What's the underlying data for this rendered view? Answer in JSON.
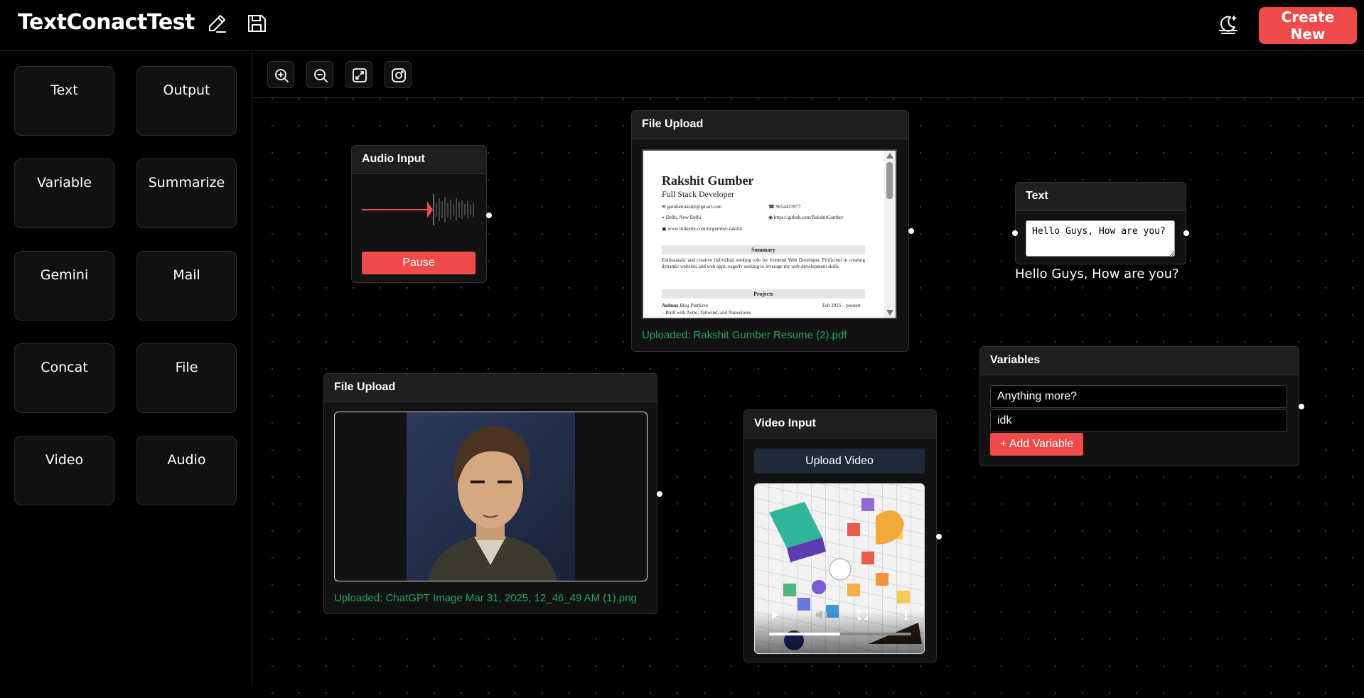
{
  "header": {
    "title": "TextConactTest",
    "edit_icon": "pencil-icon",
    "save_icon": "floppy-disk-icon",
    "theme_icon": "moon-icon",
    "create_label": "Create New"
  },
  "sidebar": {
    "items": [
      {
        "label": "Text"
      },
      {
        "label": "Output"
      },
      {
        "label": "Variable"
      },
      {
        "label": "Summarize"
      },
      {
        "label": "Gemini"
      },
      {
        "label": "Mail"
      },
      {
        "label": "Concat"
      },
      {
        "label": "File"
      },
      {
        "label": "Video"
      },
      {
        "label": "Audio"
      }
    ]
  },
  "toolbar": {
    "buttons": [
      "zoom-in-icon",
      "zoom-out-icon",
      "fit-view-icon",
      "screenshot-icon"
    ]
  },
  "nodes": {
    "audio": {
      "title": "Audio Input",
      "pause_label": "Pause"
    },
    "file_pdf": {
      "title": "File Upload",
      "uploaded": "Uploaded: Rakshit Gumber Resume (2).pdf",
      "preview": {
        "name": "Rakshit Gumber",
        "role": "Full Stack Developer",
        "email": "gumberrakshit@gmail.com",
        "phone": "9654433977",
        "location": "Delhi, New Delhi",
        "github": "https://github.com/RakshitGumber",
        "linkedin": "www.linkedin.com/in/gumber-rakshit",
        "summary_heading": "Summary",
        "summary": "Enthusiastic and creative individual seeking role for frontend Web Developer. Proficient in creating dynamic websites and web apps, eagerly seeking to leverage my web-development skills.",
        "projects_heading": "Projects",
        "project_name": "Animus",
        "project_type": "Blog Platform",
        "project_date": "Feb 2025 – present",
        "project_detail": "– Built with Astro, Tailwind, and Nanostores"
      }
    },
    "text": {
      "title": "Text",
      "value": "Hello Guys, How are you?",
      "output": "Hello Guys, How are you?"
    },
    "file_image": {
      "title": "File Upload",
      "uploaded": "Uploaded: ChatGPT Image Mar 31, 2025, 12_46_49 AM (1).png"
    },
    "video": {
      "title": "Video Input",
      "upload_label": "Upload Video",
      "progress": 0.5
    },
    "variables": {
      "title": "Variables",
      "items": [
        "Anything more?",
        "idk"
      ],
      "add_label": "+ Add Variable"
    }
  },
  "colors": {
    "accent": "#f04b4b",
    "success": "#22a55b",
    "background": "#000000",
    "node": "#121212"
  }
}
